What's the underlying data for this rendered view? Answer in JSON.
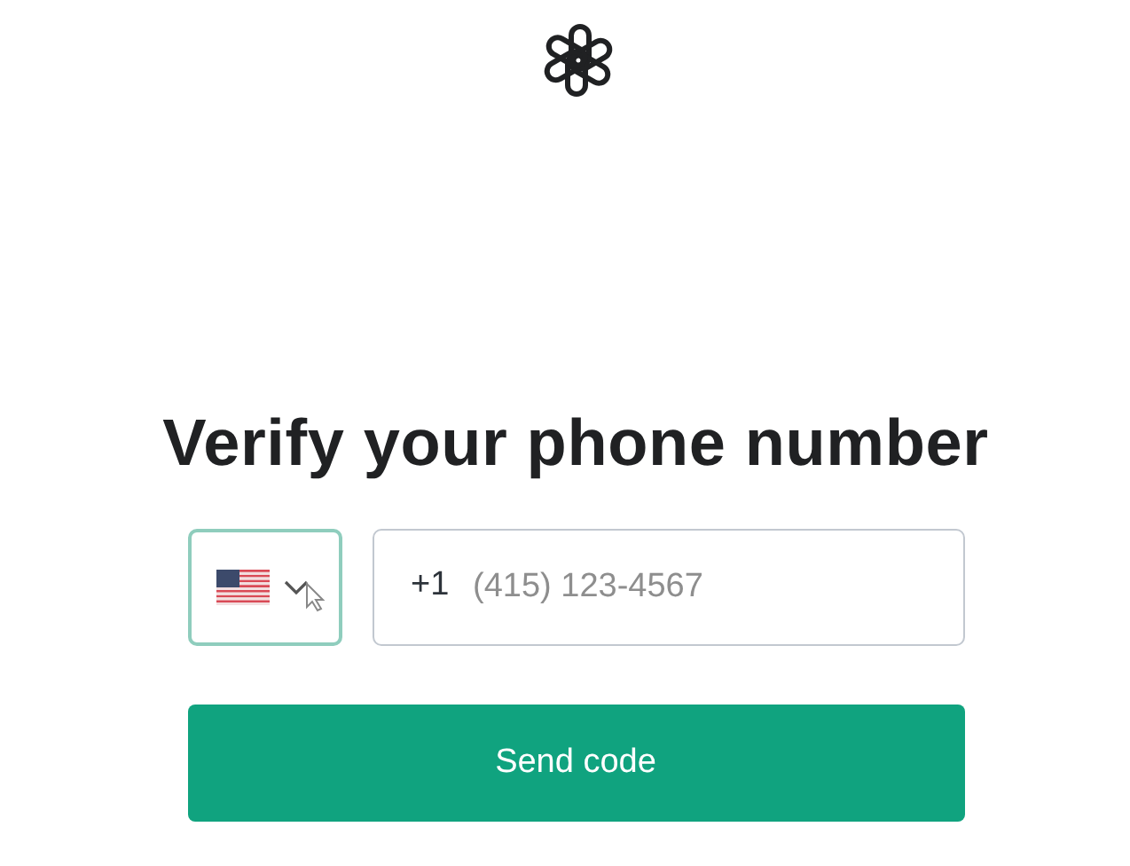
{
  "title": "Verify your phone number",
  "country_select": {
    "focused": true
  },
  "phone_field": {
    "prefix": "+1",
    "placeholder": "(415) 123-4567"
  },
  "submit_button": {
    "label": "Send code"
  }
}
